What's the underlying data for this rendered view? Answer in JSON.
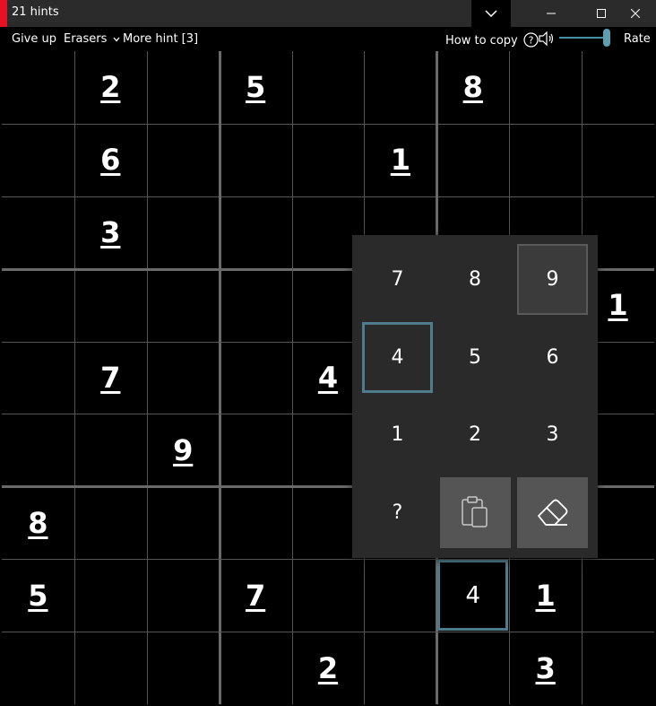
{
  "window": {
    "title": "21 hints",
    "accent_color": "#e81123",
    "collapse_icon": "chevron-down-icon",
    "minimize_icon": "minimize-icon",
    "maximize_icon": "maximize-icon",
    "close_icon": "close-icon"
  },
  "toolbar": {
    "give_up": "Give up",
    "erasers": "Erasers",
    "more_hint": "More hint [3]",
    "how_to_copy": "How to copy",
    "rate": "Rate",
    "volume_level": 1.0
  },
  "board": {
    "grid": [
      [
        "",
        "2",
        "",
        "5",
        "",
        "",
        "8",
        "",
        ""
      ],
      [
        "",
        "6",
        "",
        "",
        "",
        "1",
        "",
        "",
        ""
      ],
      [
        "",
        "3",
        "",
        "",
        "",
        "",
        "",
        "",
        ""
      ],
      [
        "",
        "",
        "",
        "",
        "",
        "",
        "",
        "",
        "1"
      ],
      [
        "",
        "7",
        "",
        "",
        "4",
        "",
        "",
        "",
        ""
      ],
      [
        "",
        "",
        "9",
        "",
        "",
        "",
        "",
        "",
        ""
      ],
      [
        "8",
        "",
        "",
        "",
        "",
        "",
        "",
        "",
        ""
      ],
      [
        "5",
        "",
        "",
        "7",
        "",
        "",
        "4",
        "1",
        ""
      ],
      [
        "",
        "",
        "",
        "",
        "2",
        "",
        "",
        "3",
        ""
      ]
    ],
    "entered_cells": [
      [
        7,
        6
      ]
    ],
    "selected_cell": [
      7,
      6
    ],
    "grid_line_color": "#555555",
    "selection_color": "#4f7c8c"
  },
  "numpad": {
    "rows": [
      [
        "7",
        "8",
        "9"
      ],
      [
        "4",
        "5",
        "6"
      ],
      [
        "1",
        "2",
        "3"
      ]
    ],
    "selected": "4",
    "hovered": "9",
    "unknown": "?",
    "paste_icon": "clipboard-paste-icon",
    "eraser_icon": "eraser-icon"
  }
}
